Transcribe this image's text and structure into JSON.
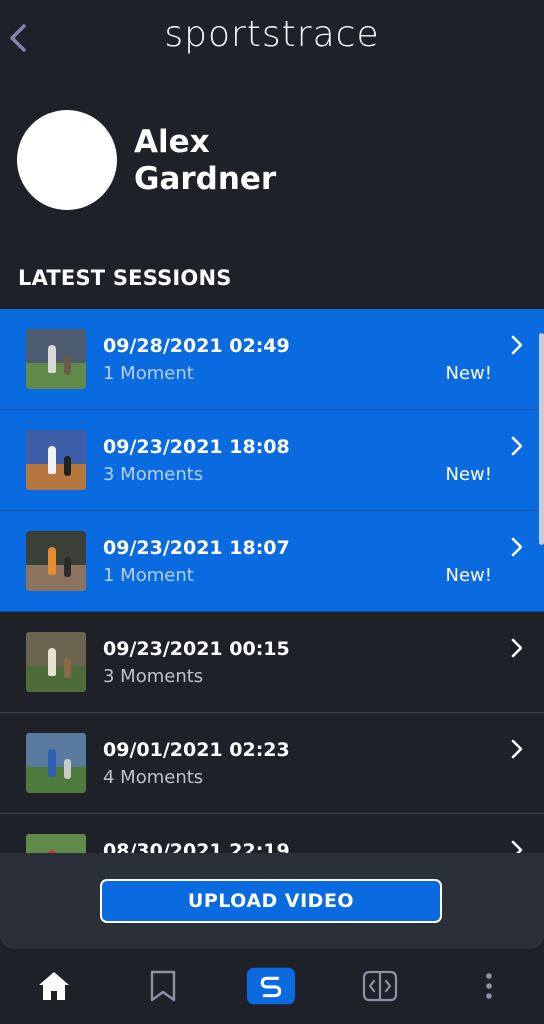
{
  "app": {
    "brand": "sportstrace"
  },
  "profile": {
    "first_name": "Alex",
    "last_name": "Gardner"
  },
  "section_title": "LATEST SESSIONS",
  "sessions": [
    {
      "date": "09/28/2021 02:49",
      "moments": "1 Moment",
      "badge": "New!",
      "is_new": true
    },
    {
      "date": "09/23/2021 18:08",
      "moments": "3 Moments",
      "badge": "New!",
      "is_new": true
    },
    {
      "date": "09/23/2021 18:07",
      "moments": "1 Moment",
      "badge": "New!",
      "is_new": true
    },
    {
      "date": "09/23/2021 00:15",
      "moments": "3 Moments",
      "badge": "",
      "is_new": false
    },
    {
      "date": "09/01/2021 02:23",
      "moments": "4 Moments",
      "badge": "",
      "is_new": false
    },
    {
      "date": "08/30/2021 22:19",
      "moments": "",
      "badge": "",
      "is_new": false
    }
  ],
  "upload": {
    "label": "UPLOAD VIDEO"
  },
  "colors": {
    "background": "#1e2128",
    "accent": "#0a6ae0",
    "panel": "#2b2f37",
    "back_arrow": "#7f86ad"
  },
  "tabs": [
    {
      "icon": "home-icon",
      "active": true
    },
    {
      "icon": "bookmark-icon",
      "active": false
    },
    {
      "icon": "sportstrace-logo-icon",
      "active": false
    },
    {
      "icon": "compare-icon",
      "active": false
    },
    {
      "icon": "more-vertical-icon",
      "active": false
    }
  ]
}
